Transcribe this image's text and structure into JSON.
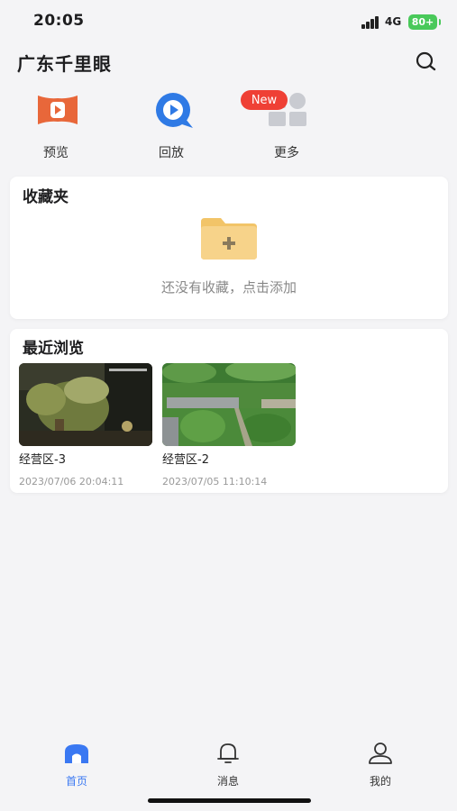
{
  "status_bar": {
    "time": "20:05",
    "network": "4G",
    "battery": "80+"
  },
  "header": {
    "title": "广东千里眼",
    "search_icon": "search-icon"
  },
  "quick_actions": [
    {
      "label": "预览",
      "icon": "preview-play-icon"
    },
    {
      "label": "回放",
      "icon": "playback-icon"
    },
    {
      "label": "更多",
      "icon": "grid-more-icon",
      "badge": "New"
    }
  ],
  "favorites": {
    "title": "收藏夹",
    "empty_text": "还没有收藏，点击添加",
    "icon": "add-folder-icon"
  },
  "recent": {
    "title": "最近浏览",
    "items": [
      {
        "name": "经营区-3",
        "time": "2023/07/06 20:04:11"
      },
      {
        "name": "经营区-2",
        "time": "2023/07/05 11:10:14"
      }
    ]
  },
  "tab_bar": {
    "tabs": [
      {
        "label": "首页",
        "icon": "home-icon",
        "active": true
      },
      {
        "label": "消息",
        "icon": "bell-icon",
        "active": false
      },
      {
        "label": "我的",
        "icon": "user-icon",
        "active": false
      }
    ]
  },
  "colors": {
    "accent": "#3a78f2",
    "badge": "#ef4035",
    "battery": "#49c95a",
    "preview_icon": "#e8673a",
    "folder": "#f6cf7e"
  }
}
